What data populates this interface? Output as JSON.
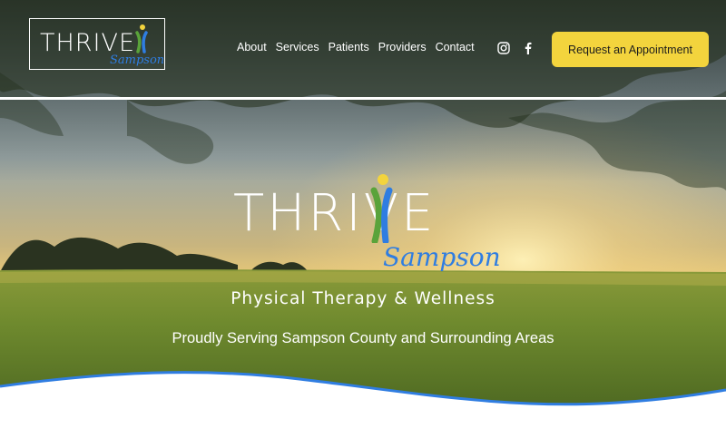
{
  "header": {
    "logo": {
      "word": "THRIVE",
      "sub": "Sampson"
    },
    "nav": [
      {
        "label": "About"
      },
      {
        "label": "Services"
      },
      {
        "label": "Patients"
      },
      {
        "label": "Providers"
      },
      {
        "label": "Contact"
      }
    ],
    "social": [
      {
        "icon": "instagram-icon"
      },
      {
        "icon": "facebook-icon"
      }
    ],
    "cta_label": "Request an Appointment"
  },
  "hero": {
    "logo": {
      "word": "THRIVE",
      "sub": "Sampson"
    },
    "tagline": "Physical Therapy & Wellness",
    "serving": "Proudly Serving Sampson County and Surrounding Areas"
  },
  "colors": {
    "accent_blue": "#2f7de1",
    "accent_yellow": "#f3d43d",
    "logo_green": "#5aa33a",
    "wave_blue": "#2f7de1"
  }
}
